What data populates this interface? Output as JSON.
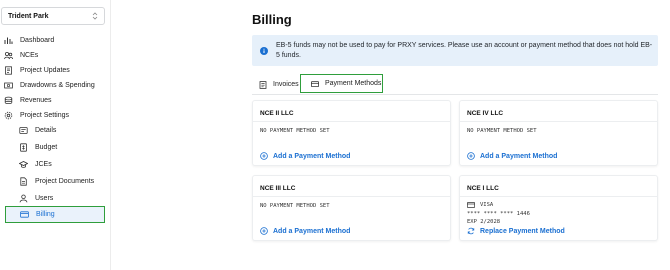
{
  "sidebar": {
    "org": "Trident Park",
    "items": [
      {
        "label": "Dashboard"
      },
      {
        "label": "NCEs"
      },
      {
        "label": "Project Updates"
      },
      {
        "label": "Drawdowns & Spending"
      },
      {
        "label": "Revenues"
      },
      {
        "label": "Project Settings"
      }
    ],
    "sub_items": [
      {
        "label": "Details"
      },
      {
        "label": "Budget"
      },
      {
        "label": "JCEs"
      },
      {
        "label": "Project Documents"
      },
      {
        "label": "Users"
      },
      {
        "label": "Billing"
      }
    ]
  },
  "main": {
    "title": "Billing",
    "alert": "EB-5 funds may not be used to pay for PRXY services. Please use an account or payment method that does not hold EB-5 funds.",
    "tabs": [
      {
        "label": "Invoices"
      },
      {
        "label": "Payment Methods"
      }
    ],
    "cards": [
      {
        "name": "NCE II LLC",
        "status": "NO PAYMENT METHOD SET",
        "action": "Add a Payment Method"
      },
      {
        "name": "NCE IV LLC",
        "status": "NO PAYMENT METHOD SET",
        "action": "Add a Payment Method"
      },
      {
        "name": "NCE III LLC",
        "status": "NO PAYMENT METHOD SET",
        "action": "Add a Payment Method"
      },
      {
        "name": "NCE I LLC",
        "brand": "VISA",
        "number": "**** **** **** 1446",
        "exp": "EXP 2/2028",
        "action": "Replace Payment Method"
      }
    ]
  },
  "colors": {
    "accent": "#1a6fd1",
    "highlight": "#2f9e3c",
    "alert_bg": "#e6f0fa"
  }
}
